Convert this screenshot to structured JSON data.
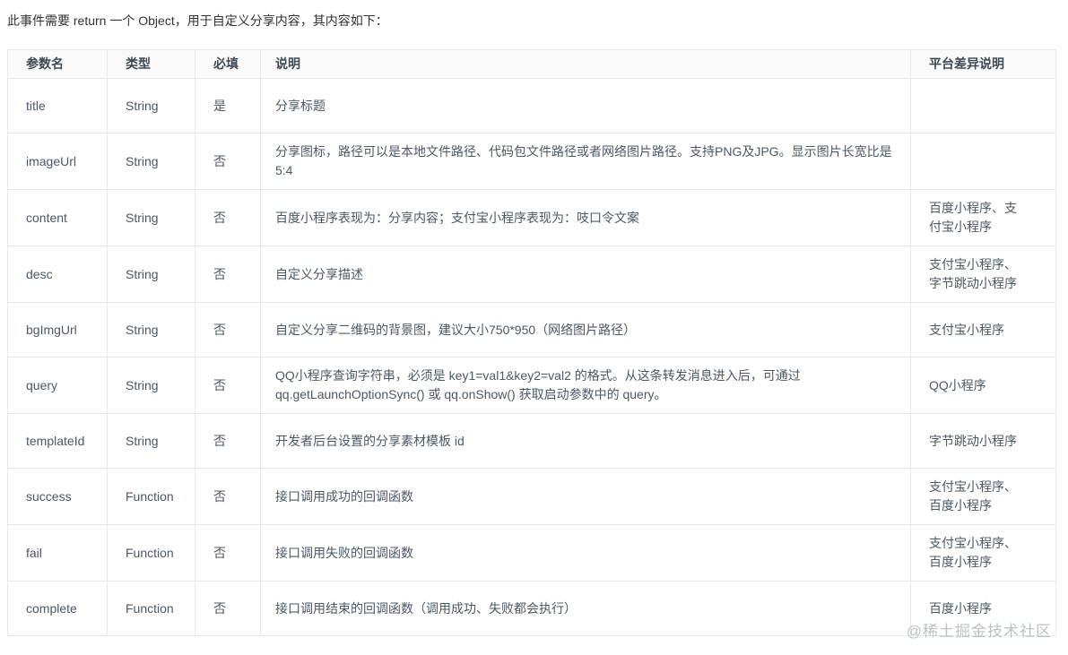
{
  "intro": "此事件需要 return 一个 Object，用于自定义分享内容，其内容如下：",
  "table": {
    "headers": [
      "参数名",
      "类型",
      "必填",
      "说明",
      "平台差异说明"
    ],
    "rows": [
      {
        "name": "title",
        "type": "String",
        "required": "是",
        "description": "分享标题",
        "platform": ""
      },
      {
        "name": "imageUrl",
        "type": "String",
        "required": "否",
        "description": "分享图标，路径可以是本地文件路径、代码包文件路径或者网络图片路径。支持PNG及JPG。显示图片长宽比是 5:4",
        "platform": ""
      },
      {
        "name": "content",
        "type": "String",
        "required": "否",
        "description": "百度小程序表现为：分享内容；支付宝小程序表现为：吱口令文案",
        "platform": "百度小程序、支付宝小程序"
      },
      {
        "name": "desc",
        "type": "String",
        "required": "否",
        "description": "自定义分享描述",
        "platform": "支付宝小程序、字节跳动小程序"
      },
      {
        "name": "bgImgUrl",
        "type": "String",
        "required": "否",
        "description": "自定义分享二维码的背景图，建议大小750*950（网络图片路径）",
        "platform": "支付宝小程序"
      },
      {
        "name": "query",
        "type": "String",
        "required": "否",
        "description": "QQ小程序查询字符串，必须是 key1=val1&key2=val2 的格式。从这条转发消息进入后，可通过 qq.getLaunchOptionSync() 或 qq.onShow() 获取启动参数中的 query。",
        "platform": "QQ小程序"
      },
      {
        "name": "templateId",
        "type": "String",
        "required": "否",
        "description": "开发者后台设置的分享素材模板 id",
        "platform": "字节跳动小程序"
      },
      {
        "name": "success",
        "type": "Function",
        "required": "否",
        "description": "接口调用成功的回调函数",
        "platform": "支付宝小程序、百度小程序"
      },
      {
        "name": "fail",
        "type": "Function",
        "required": "否",
        "description": "接口调用失败的回调函数",
        "platform": "支付宝小程序、百度小程序"
      },
      {
        "name": "complete",
        "type": "Function",
        "required": "否",
        "description": "接口调用结束的回调函数（调用成功、失败都会执行）",
        "platform": "百度小程序"
      }
    ]
  },
  "watermark": "@稀土掘金技术社区",
  "colors": {
    "header_bg": "#fafafa",
    "border": "#e6e8ea",
    "body_text": "#4b5866",
    "header_text": "#3e4a54",
    "watermark_text": "#bdc1c7"
  }
}
